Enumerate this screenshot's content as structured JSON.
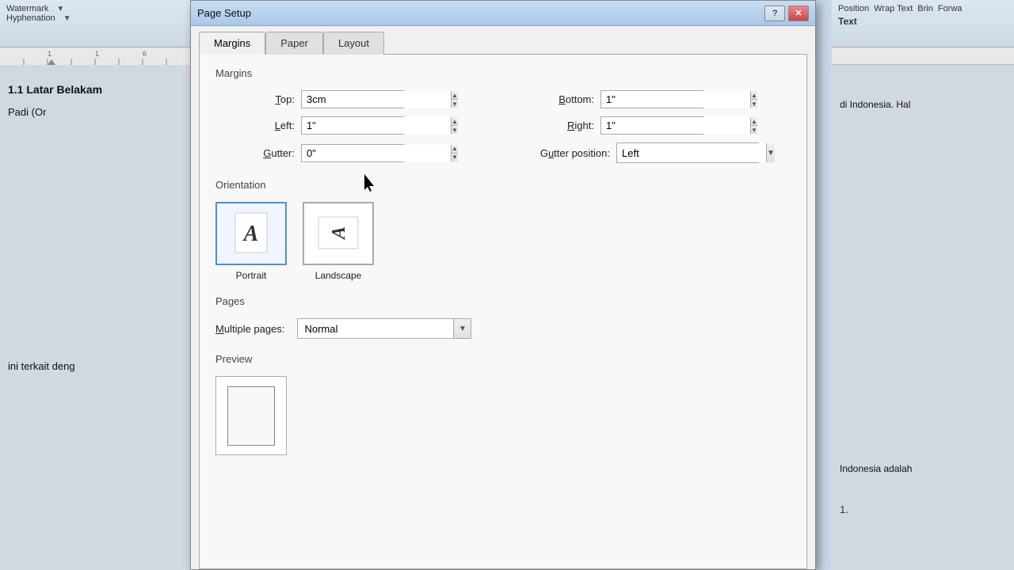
{
  "app": {
    "title": "Page Setup"
  },
  "dialog": {
    "title": "Page Setup",
    "tabs": [
      {
        "label": "Margins",
        "active": true
      },
      {
        "label": "Paper",
        "active": false
      },
      {
        "label": "Layout",
        "active": false
      }
    ],
    "close_btn": "✕",
    "help_btn": "?"
  },
  "margins_section": {
    "label": "Margins",
    "fields": {
      "top": {
        "label": "Top:",
        "value": "3cm",
        "underline_char": "T"
      },
      "bottom": {
        "label": "Bottom:",
        "value": "1\"",
        "underline_char": "B"
      },
      "left": {
        "label": "Left:",
        "value": "1\"",
        "underline_char": "L"
      },
      "right": {
        "label": "Right:",
        "value": "1\"",
        "underline_char": "R"
      },
      "gutter": {
        "label": "Gutter:",
        "value": "0\"",
        "underline_char": "G"
      },
      "gutter_position": {
        "label": "Gutter position:",
        "value": "Left",
        "underline_char": "u"
      }
    }
  },
  "orientation_section": {
    "label": "Orientation",
    "options": [
      {
        "id": "portrait",
        "label": "Portrait",
        "selected": true
      },
      {
        "id": "landscape",
        "label": "Landscape",
        "selected": false
      }
    ]
  },
  "pages_section": {
    "label": "Pages",
    "multiple_pages_label": "Multiple pages:",
    "multiple_pages_value": "Normal",
    "underline_char": "M"
  },
  "preview_section": {
    "label": "Preview"
  },
  "doc_left": {
    "ribbon_items": [
      "Watermark",
      "Hyphenation"
    ],
    "heading": "1.1  Latar Belakam",
    "text1": "Padi (Or",
    "text2": "ini terkait deng"
  },
  "doc_right": {
    "ribbon_items": [
      "Position",
      "Wrap Text",
      "Brin",
      "Forwa"
    ],
    "tab_label": "Text",
    "text1": "di Indonesia. Hal",
    "text2": "Indonesia adalah"
  }
}
